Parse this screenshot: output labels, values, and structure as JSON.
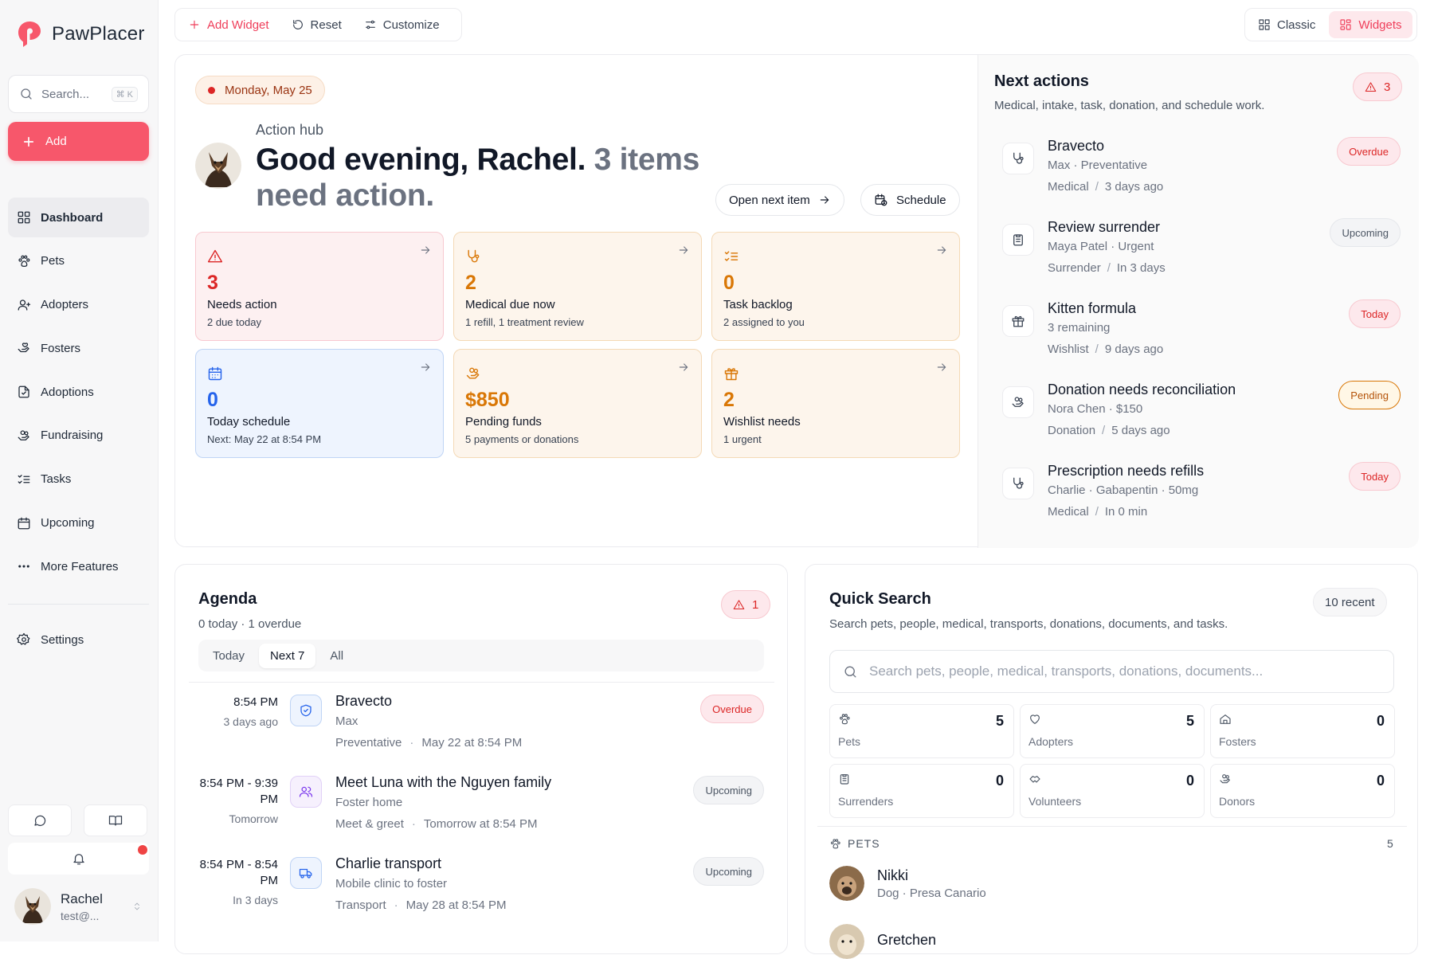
{
  "brand": {
    "name": "PawPlacer"
  },
  "sidebar": {
    "search_label": "Search...",
    "search_shortcut": "⌘ K",
    "add_label": "Add",
    "items": [
      {
        "label": "Dashboard",
        "icon": "dashboard-icon"
      },
      {
        "label": "Pets",
        "icon": "paw-icon"
      },
      {
        "label": "Adopters",
        "icon": "user-icon"
      },
      {
        "label": "Fosters",
        "icon": "hand-heart-icon"
      },
      {
        "label": "Adoptions",
        "icon": "document-icon"
      },
      {
        "label": "Fundraising",
        "icon": "hand-coins-icon"
      },
      {
        "label": "Tasks",
        "icon": "checklist-icon"
      },
      {
        "label": "Upcoming",
        "icon": "calendar-icon"
      },
      {
        "label": "More Features",
        "icon": "ellipsis-icon"
      }
    ],
    "settings_label": "Settings",
    "user": {
      "name": "Rachel",
      "email": "test@..."
    }
  },
  "toolbar": {
    "add_widget": "Add Widget",
    "reset": "Reset",
    "customize": "Customize",
    "view_classic": "Classic",
    "view_widgets": "Widgets"
  },
  "hub": {
    "date": "Monday, May 25",
    "eyebrow": "Action hub",
    "greeting": "Good evening, Rachel.",
    "greeting_count": "3 items need action.",
    "open_next": "Open next item",
    "schedule": "Schedule",
    "tiles": [
      {
        "value": "3",
        "label": "Needs action",
        "sub": "2 due today"
      },
      {
        "value": "2",
        "label": "Medical due now",
        "sub": "1 refill, 1 treatment review"
      },
      {
        "value": "0",
        "label": "Task backlog",
        "sub": "2 assigned to you"
      },
      {
        "value": "0",
        "label": "Today schedule",
        "sub": "Next: May 22 at 8:54 PM"
      },
      {
        "value": "$850",
        "label": "Pending funds",
        "sub": "5 payments or donations"
      },
      {
        "value": "2",
        "label": "Wishlist needs",
        "sub": "1 urgent"
      }
    ]
  },
  "next_actions": {
    "title": "Next actions",
    "subtitle": "Medical, intake, task, donation, and schedule work.",
    "badge": "3",
    "items": [
      {
        "title": "Bravecto",
        "line1": "Max · Preventative",
        "cat": "Medical",
        "when": "3 days ago",
        "status": "Overdue"
      },
      {
        "title": "Review surrender",
        "line1": "Maya Patel · Urgent",
        "cat": "Surrender",
        "when": "In 3 days",
        "status": "Upcoming"
      },
      {
        "title": "Kitten formula",
        "line1": "3 remaining",
        "cat": "Wishlist",
        "when": "9 days ago",
        "status": "Today"
      },
      {
        "title": "Donation needs reconciliation",
        "line1": "Nora Chen · $150",
        "cat": "Donation",
        "when": "5 days ago",
        "status": "Pending"
      },
      {
        "title": "Prescription needs refills",
        "line1": "Charlie · Gabapentin · 50mg",
        "cat": "Medical",
        "when": "In 0 min",
        "status": "Today"
      }
    ],
    "sep": "/"
  },
  "agenda": {
    "title": "Agenda",
    "subtitle": "0 today · 1 overdue",
    "badge": "1",
    "tabs": [
      "Today",
      "Next 7",
      "All"
    ],
    "dot": "·",
    "items": [
      {
        "time": "8:54 PM",
        "rel": "3 days ago",
        "title": "Bravecto",
        "line1": "Max",
        "cat": "Preventative",
        "when": "May 22 at 8:54 PM",
        "status": "Overdue"
      },
      {
        "time": "8:54 PM - 9:39 PM",
        "rel": "Tomorrow",
        "title": "Meet Luna with the Nguyen family",
        "line1": "Foster home",
        "cat": "Meet & greet",
        "when": "Tomorrow at 8:54 PM",
        "status": "Upcoming"
      },
      {
        "time": "8:54 PM - 8:54 PM",
        "rel": "In 3 days",
        "title": "Charlie transport",
        "line1": "Mobile clinic to foster",
        "cat": "Transport",
        "when": "May 28 at 8:54 PM",
        "status": "Upcoming"
      }
    ]
  },
  "quick_search": {
    "title": "Quick Search",
    "subtitle": "Search pets, people, medical, transports, donations, documents, and tasks.",
    "recent": "10 recent",
    "placeholder": "Search pets, people, medical, transports, donations, documents...",
    "tiles": [
      {
        "label": "Pets",
        "count": "5"
      },
      {
        "label": "Adopters",
        "count": "5"
      },
      {
        "label": "Fosters",
        "count": "0"
      },
      {
        "label": "Surrenders",
        "count": "0"
      },
      {
        "label": "Volunteers",
        "count": "0"
      },
      {
        "label": "Donors",
        "count": "0"
      }
    ],
    "section": "PETS",
    "section_count": "5",
    "pets": [
      {
        "name": "Nikki",
        "desc": "Dog · Presa Canario"
      },
      {
        "name": "Gretchen",
        "desc": ""
      }
    ]
  },
  "colors": {
    "accent": "#f7576b",
    "danger": "#dc2626",
    "amber": "#d97706",
    "blue": "#2563eb"
  }
}
